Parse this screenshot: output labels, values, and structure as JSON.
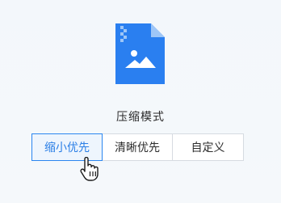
{
  "panel": {
    "file_icon": "image-file-icon",
    "mode_label": "压缩模式",
    "options": [
      {
        "label": "缩小优先",
        "selected": true
      },
      {
        "label": "清晰优先",
        "selected": false
      },
      {
        "label": "自定义",
        "selected": false
      }
    ]
  },
  "cursor_icon": "hand-pointer-icon",
  "colors": {
    "accent": "#2b86f0",
    "file_icon_bg": "#2a7ff0",
    "selected_bg": "#eef5fd"
  }
}
